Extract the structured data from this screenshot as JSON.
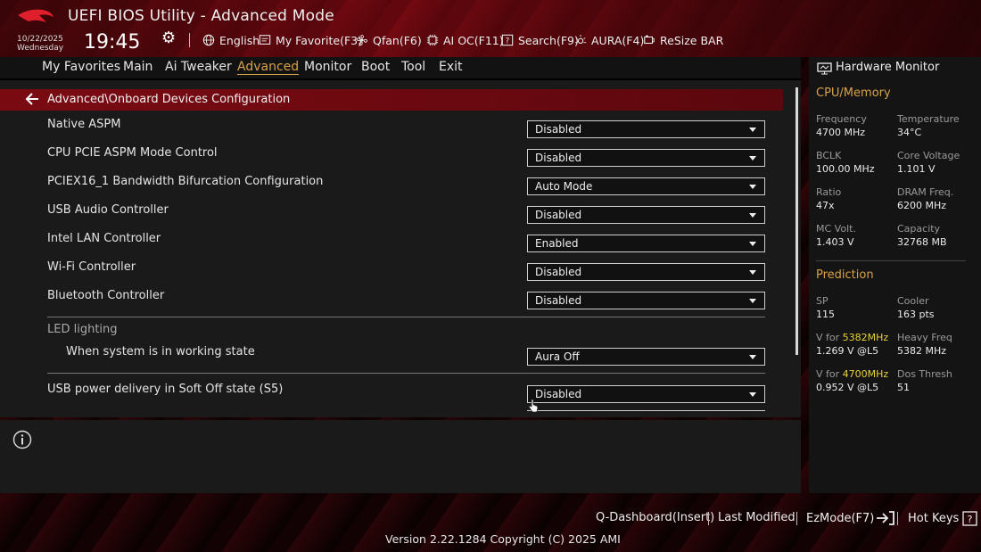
{
  "header": {
    "app_title": "UEFI BIOS Utility - Advanced Mode",
    "date": "10/22/2025",
    "weekday": "Wednesday",
    "time": "19:45",
    "toolbar": {
      "language": "English",
      "favorite": "My Favorite(F3)",
      "qfan": "Qfan(F6)",
      "aioc": "AI OC(F11)",
      "search": "Search(F9)",
      "aura": "AURA(F4)",
      "resize_bar": "ReSize BAR"
    }
  },
  "menu": {
    "items": [
      "My Favorites",
      "Main",
      "Ai Tweaker",
      "Advanced",
      "Monitor",
      "Boot",
      "Tool",
      "Exit"
    ],
    "active": "Advanced"
  },
  "main": {
    "breadcrumb": "Advanced\\Onboard Devices Configuration",
    "settings": [
      {
        "label": "Native ASPM",
        "value": "Disabled"
      },
      {
        "label": "CPU PCIE ASPM Mode Control",
        "value": "Disabled"
      },
      {
        "label": "PCIEX16_1 Bandwidth Bifurcation Configuration",
        "value": "Auto Mode"
      },
      {
        "label": "USB Audio Controller",
        "value": "Disabled"
      },
      {
        "label": "Intel LAN Controller",
        "value": "Enabled"
      },
      {
        "label": "Wi-Fi Controller",
        "value": "Disabled"
      },
      {
        "label": "Bluetooth Controller",
        "value": "Disabled"
      }
    ],
    "led_section": "LED lighting",
    "led_working": {
      "label": "When system is in working state",
      "value": "Aura Off"
    },
    "usb_s5": {
      "label": "USB power delivery in Soft Off state (S5)",
      "value": "Disabled"
    }
  },
  "hwmon": {
    "title": "Hardware Monitor",
    "cpu_section": "CPU/Memory",
    "frequency_label": "Frequency",
    "frequency_value": "4700 MHz",
    "temperature_label": "Temperature",
    "temperature_value": "34°C",
    "bclk_label": "BCLK",
    "bclk_value": "100.00 MHz",
    "core_voltage_label": "Core Voltage",
    "core_voltage_value": "1.101 V",
    "ratio_label": "Ratio",
    "ratio_value": "47x",
    "dram_freq_label": "DRAM Freq.",
    "dram_freq_value": "6200 MHz",
    "mc_volt_label": "MC Volt.",
    "mc_volt_value": "1.403 V",
    "capacity_label": "Capacity",
    "capacity_value": "32768 MB",
    "prediction_section": "Prediction",
    "sp_label": "SP",
    "sp_value": "115",
    "cooler_label": "Cooler",
    "cooler_value": "163 pts",
    "vfor1_prefix": "V for ",
    "vfor1_freq": "5382MHz",
    "vfor1_value": "1.269 V @L5",
    "heavy_freq_label": "Heavy Freq",
    "heavy_freq_value": "5382 MHz",
    "vfor2_prefix": "V for ",
    "vfor2_freq": "4700MHz",
    "vfor2_value": "0.952 V @L5",
    "dos_thresh_label": "Dos Thresh",
    "dos_thresh_value": "51"
  },
  "footer": {
    "qdashboard": "Q-Dashboard(Insert)",
    "last_modified": "Last Modified",
    "ezmode": "EzMode(F7)",
    "hotkeys": "Hot Keys",
    "version": "Version 2.22.1284 Copyright (C) 2025 AMI"
  },
  "colors": {
    "accent": "#d9a24a",
    "highlight": "#e8d23a",
    "crumb_bar": "#7a0a12"
  }
}
